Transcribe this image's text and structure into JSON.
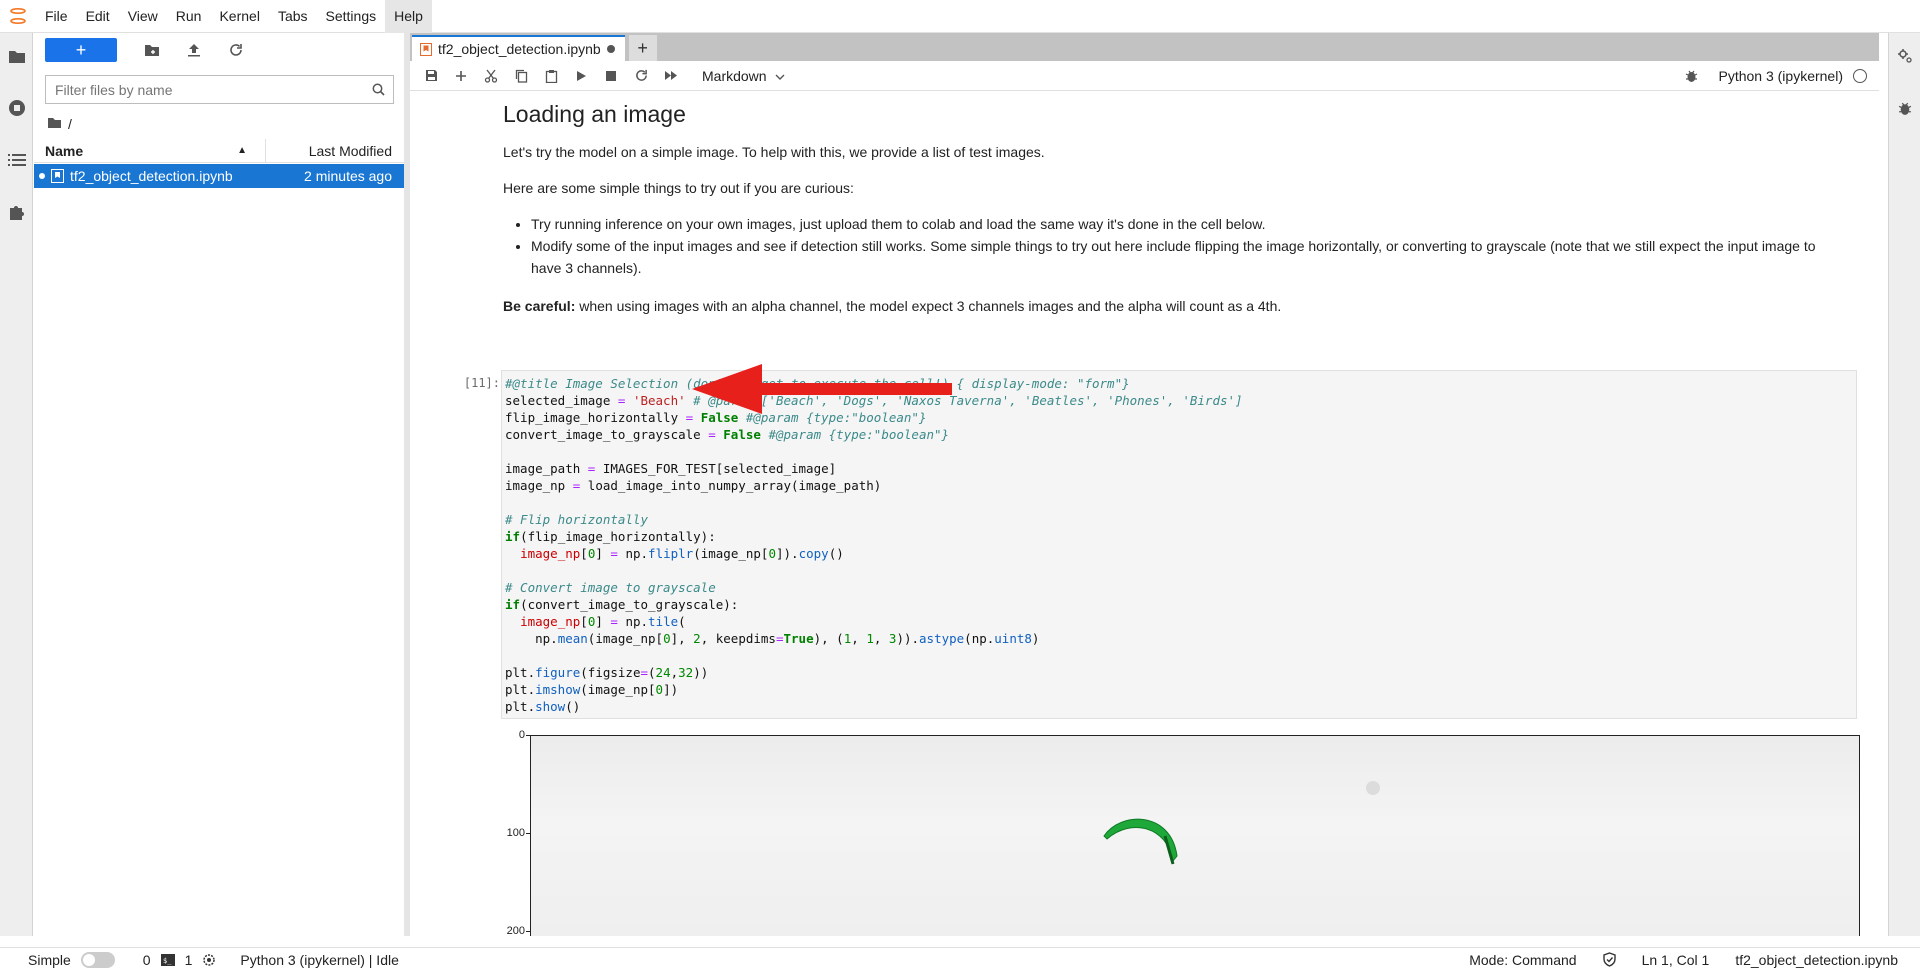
{
  "menubar": {
    "items": [
      "File",
      "Edit",
      "View",
      "Run",
      "Kernel",
      "Tabs",
      "Settings",
      "Help"
    ]
  },
  "filebrowser": {
    "new_label": "+",
    "search_placeholder": "Filter files by name",
    "breadcrumb": "/",
    "col_name": "Name",
    "col_modified": "Last Modified",
    "files": [
      {
        "name": "tf2_object_detection.ipynb",
        "modified": "2 minutes ago"
      }
    ]
  },
  "notebook": {
    "tab_title": "tf2_object_detection.ipynb",
    "cell_type": "Markdown",
    "kernel_name": "Python 3 (ipykernel)",
    "heading": "Loading an image",
    "para1": "Let's try the model on a simple image. To help with this, we provide a list of test images.",
    "para2": "Here are some simple things to try out if you are curious:",
    "bullets": [
      "Try running inference on your own images, just upload them to colab and load the same way it's done in the cell below.",
      "Modify some of the input images and see if detection still works. Some simple things to try out here include flipping the image horizontally, or converting to grayscale (note that we still expect the input image to have 3 channels)."
    ],
    "careful_bold": "Be careful:",
    "careful_text": " when using images with an alpha channel, the model expect 3 channels images and the alpha will count as a 4th.",
    "cell_prompt": "[11]:",
    "plot_yticks": [
      "0",
      "100",
      "200"
    ]
  },
  "statusbar": {
    "mode_label": "Simple",
    "terminals": "0",
    "kernels": "1",
    "kernel_status": "Python 3 (ipykernel) | Idle",
    "mode": "Mode: Command",
    "position": "Ln 1, Col 1",
    "filename": "tf2_object_detection.ipynb"
  },
  "colors": {
    "accent": "#1976d2",
    "arrow": "#e8201c",
    "kite": "#1fa83a"
  }
}
